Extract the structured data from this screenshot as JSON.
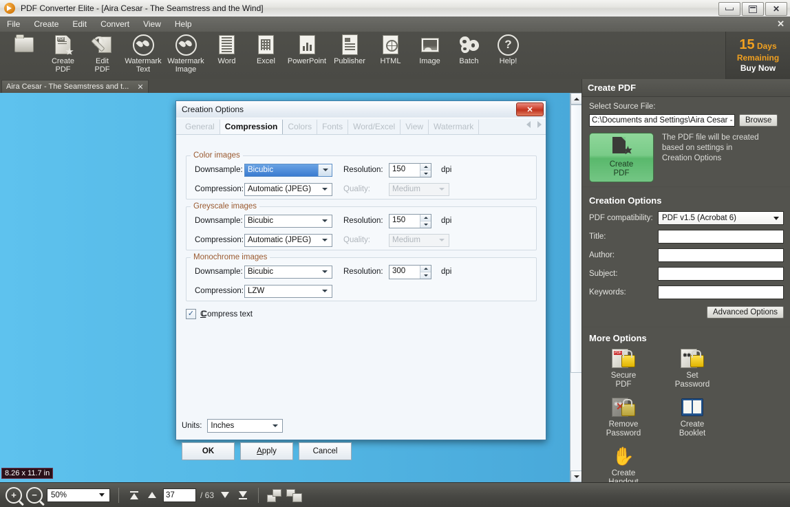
{
  "window": {
    "title": "PDF Converter Elite - [Aira Cesar - The Seamstress and the Wind]",
    "minimize": "Minimize",
    "maximize": "Maximize",
    "close": "Close"
  },
  "menu": {
    "items": [
      "File",
      "Create",
      "Edit",
      "Convert",
      "View",
      "Help"
    ],
    "close_doc": "✕"
  },
  "toolbar": {
    "items": [
      {
        "label": "Open",
        "icon": "folder-icon"
      },
      {
        "label": "Create\nPDF",
        "l1": "Create",
        "l2": "PDF",
        "icon": "create-pdf-icon"
      },
      {
        "label": "Edit\nPDF",
        "l1": "Edit",
        "l2": "PDF",
        "icon": "edit-pdf-icon"
      },
      {
        "label": "Watermark\nText",
        "l1": "Watermark",
        "l2": "Text",
        "icon": "watermark-text-icon"
      },
      {
        "label": "Watermark\nImage",
        "l1": "Watermark",
        "l2": "Image",
        "icon": "watermark-image-icon"
      },
      {
        "label": "Word",
        "l1": "Word",
        "l2": "",
        "icon": "word-icon"
      },
      {
        "label": "Excel",
        "l1": "Excel",
        "l2": "",
        "icon": "excel-icon"
      },
      {
        "label": "PowerPoint",
        "l1": "PowerPoint",
        "l2": "",
        "icon": "powerpoint-icon"
      },
      {
        "label": "Publisher",
        "l1": "Publisher",
        "l2": "",
        "icon": "publisher-icon"
      },
      {
        "label": "HTML",
        "l1": "HTML",
        "l2": "",
        "icon": "html-icon"
      },
      {
        "label": "Image",
        "l1": "Image",
        "l2": "",
        "icon": "image-icon"
      },
      {
        "label": "Batch",
        "l1": "Batch",
        "l2": "",
        "icon": "batch-gears-icon"
      },
      {
        "label": "Help!",
        "l1": "Help!",
        "l2": "",
        "icon": "help-question-icon"
      }
    ]
  },
  "trial": {
    "days": "15",
    "days_word": "Days",
    "remaining": "Remaining",
    "buy": "Buy Now",
    "accent": "#f0a020"
  },
  "doc_tab": {
    "label": "Aira Cesar - The Seamstress and t...",
    "close": "✕"
  },
  "canvas": {
    "page_size": "8.26 x 11.7 in"
  },
  "sidebar": {
    "header": "Create PDF",
    "source_label": "Select Source File:",
    "source_value": "C:\\Documents and Settings\\Aira Cesar - Th",
    "browse": "Browse",
    "create_button": {
      "l1": "Create",
      "l2": "PDF"
    },
    "create_note": "The PDF file will be created based on settings in Creation Options",
    "create_note_lines": [
      "The PDF file will be created",
      "based on settings in",
      "Creation Options"
    ],
    "creation_options_title": "Creation Options",
    "fields": [
      {
        "label": "PDF compatibility:",
        "value": "PDF v1.5 (Acrobat 6)",
        "type": "select"
      },
      {
        "label": "Title:",
        "value": "",
        "type": "text"
      },
      {
        "label": "Author:",
        "value": "",
        "type": "text"
      },
      {
        "label": "Subject:",
        "value": "",
        "type": "text"
      },
      {
        "label": "Keywords:",
        "value": "",
        "type": "text"
      }
    ],
    "advanced": "Advanced Options",
    "more_options_title": "More Options",
    "more_options": [
      {
        "l1": "Secure",
        "l2": "PDF",
        "icon": "secure-pdf-icon"
      },
      {
        "l1": "Set",
        "l2": "Password",
        "icon": "set-password-icon"
      },
      {
        "l1": "Remove",
        "l2": "Password",
        "icon": "remove-password-icon"
      },
      {
        "l1": "Create",
        "l2": "Booklet",
        "icon": "create-booklet-icon"
      },
      {
        "l1": "Create",
        "l2": "Handout",
        "icon": "create-handout-icon"
      }
    ]
  },
  "dialog": {
    "title": "Creation Options",
    "close": "✕",
    "tabs": [
      {
        "label": "General",
        "active": false
      },
      {
        "label": "Compression",
        "active": true
      },
      {
        "label": "Colors",
        "active": false
      },
      {
        "label": "Fonts",
        "active": false
      },
      {
        "label": "Word/Excel",
        "active": false
      },
      {
        "label": "View",
        "active": false
      },
      {
        "label": "Watermark",
        "active": false
      }
    ],
    "groups": [
      {
        "title": "Color images",
        "downsample_label": "Downsample:",
        "downsample_value": "Bicubic",
        "downsample_selected": true,
        "resolution_label": "Resolution:",
        "resolution_value": "150",
        "dpi": "dpi",
        "compression_label": "Compression:",
        "compression_value": "Automatic (JPEG)",
        "quality_label": "Quality:",
        "quality_value": "Medium",
        "quality_enabled": false
      },
      {
        "title": "Greyscale images",
        "downsample_label": "Downsample:",
        "downsample_value": "Bicubic",
        "downsample_selected": false,
        "resolution_label": "Resolution:",
        "resolution_value": "150",
        "dpi": "dpi",
        "compression_label": "Compression:",
        "compression_value": "Automatic (JPEG)",
        "quality_label": "Quality:",
        "quality_value": "Medium",
        "quality_enabled": false
      },
      {
        "title": "Monochrome images",
        "downsample_label": "Downsample:",
        "downsample_value": "Bicubic",
        "downsample_selected": false,
        "resolution_label": "Resolution:",
        "resolution_value": "300",
        "dpi": "dpi",
        "compression_label": "Compression:",
        "compression_value": "LZW",
        "quality_label": "",
        "quality_value": "",
        "quality_enabled": false
      }
    ],
    "compress_text": {
      "label": "Compress text",
      "checked": true,
      "mark": "✓"
    },
    "units_label": "Units:",
    "units_value": "Inches",
    "buttons": {
      "ok": "OK",
      "apply": "Apply",
      "cancel": "Cancel"
    }
  },
  "statusbar": {
    "zoom_in": "+",
    "zoom_out": "−",
    "zoom_value": "50%",
    "page_value": "37",
    "page_total": "/ 63",
    "first_page": "first-page",
    "prev_page": "previous-page",
    "next_page": "next-page",
    "last_page": "last-page",
    "single_page": "single-page-view",
    "facing_page": "facing-page-view"
  }
}
